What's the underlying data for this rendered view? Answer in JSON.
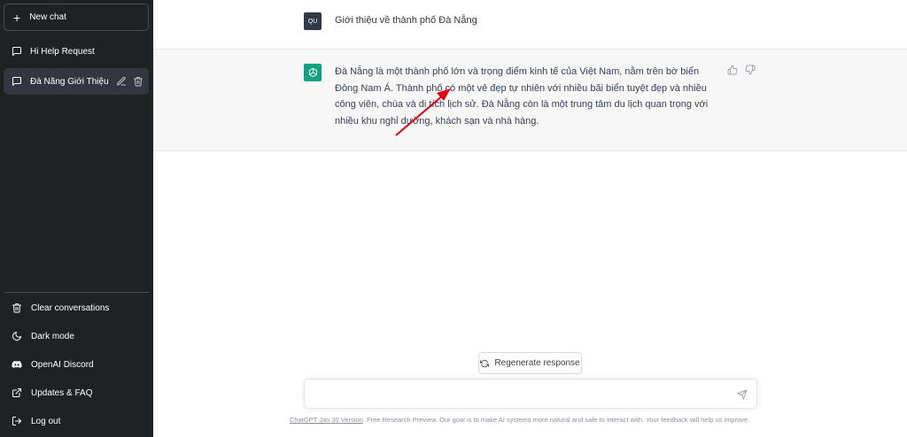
{
  "sidebar": {
    "new_chat": "New chat",
    "conversations": [
      {
        "label": "Hi Help Request",
        "icon": "chat-bubble-icon",
        "active": false
      },
      {
        "label": "Đà Nẵng Giới Thiệu",
        "icon": "chat-bubble-icon",
        "active": true
      }
    ],
    "bottom": [
      {
        "label": "Clear conversations",
        "icon": "trash-icon"
      },
      {
        "label": "Dark mode",
        "icon": "moon-icon"
      },
      {
        "label": "OpenAI Discord",
        "icon": "discord-icon"
      },
      {
        "label": "Updates & FAQ",
        "icon": "external-link-icon"
      },
      {
        "label": "Log out",
        "icon": "logout-icon"
      }
    ]
  },
  "messages": {
    "user": {
      "avatar": "QU",
      "text": "Giới thiệu về thành phố Đà Nẵng"
    },
    "assistant": {
      "text": "Đà Nẵng là một thành phố lớn và trọng điểm kinh tế của Việt Nam, nằm trên bờ biển Đông Nam Á. Thành phố có một vẻ đẹp tự nhiên với nhiều bãi biển tuyệt đẹp và nhiều công viên, chùa và di tích lịch sử. Đà Nẵng còn là một trung tâm du lịch quan trọng với nhiều khu nghỉ dưỡng, khách sạn và nhà hàng."
    }
  },
  "regenerate_label": "Regenerate response",
  "input": {
    "value": ""
  },
  "footer": {
    "link": "ChatGPT Jan 30 Version",
    "text": ". Free Research Preview. Our goal is to make AI systems more natural and safe to interact with. Your feedback will help us improve."
  },
  "colors": {
    "sidebar": "#202123",
    "active_item": "#343541",
    "assistant_bg": "#f7f7f8",
    "brand_green": "#10a37f",
    "annotation_arrow": "#e3000f"
  }
}
